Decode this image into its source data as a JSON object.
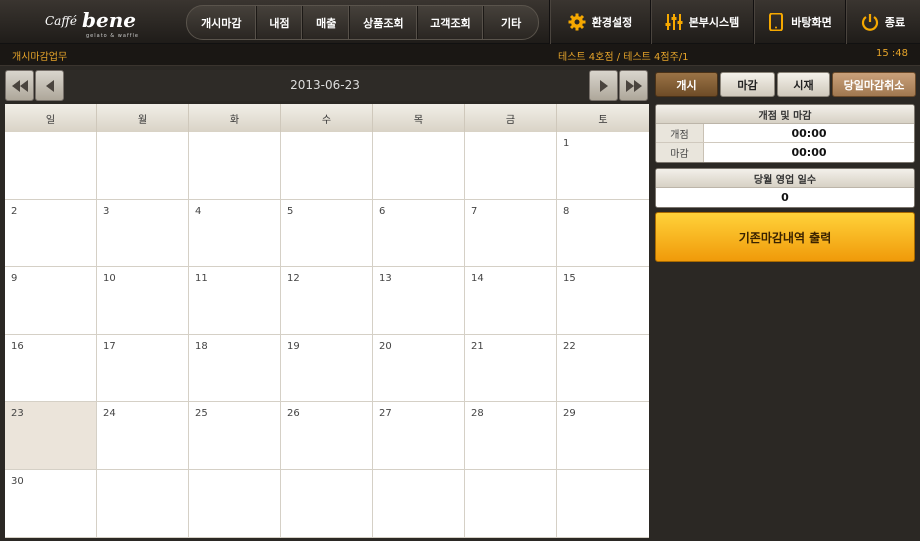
{
  "logo": {
    "line1": "Caffé",
    "line2": "bene",
    "tagline": "gelato & waffle"
  },
  "nav": [
    "개시마감",
    "내점",
    "매출",
    "상품조회",
    "고객조회",
    "기타"
  ],
  "system": {
    "settings": "환경설정",
    "hq": "본부시스템",
    "desktop": "바탕화면",
    "exit": "종료"
  },
  "status": {
    "section": "개시마감업무",
    "store": "테스트 4호점 / 테스트 4점주/1",
    "time": "15 :48"
  },
  "calendar": {
    "date": "2013-06-23",
    "weekdays": [
      "일",
      "월",
      "화",
      "수",
      "목",
      "금",
      "토"
    ],
    "days": [
      "",
      "",
      "",
      "",
      "",
      "",
      "1",
      "2",
      "3",
      "4",
      "5",
      "6",
      "7",
      "8",
      "9",
      "10",
      "11",
      "12",
      "13",
      "14",
      "15",
      "16",
      "17",
      "18",
      "19",
      "20",
      "21",
      "22",
      "23",
      "24",
      "25",
      "26",
      "27",
      "28",
      "29",
      "30",
      "",
      "",
      "",
      "",
      "",
      ""
    ],
    "selected": "23"
  },
  "tabs": {
    "open": "개시",
    "close": "마감",
    "settle": "시재",
    "cancel": "당일마감취소"
  },
  "open_close": {
    "title": "개점 및 마감",
    "open_label": "개점",
    "open_value": "00:00",
    "close_label": "마감",
    "close_value": "00:00"
  },
  "business_days": {
    "title": "당월 영업 일수",
    "value": "0"
  },
  "print_button": "기존마감내역 출력",
  "colors": {
    "accent": "#e6a42a",
    "print": "#f5b320",
    "selected_day": "#ebe4da"
  }
}
